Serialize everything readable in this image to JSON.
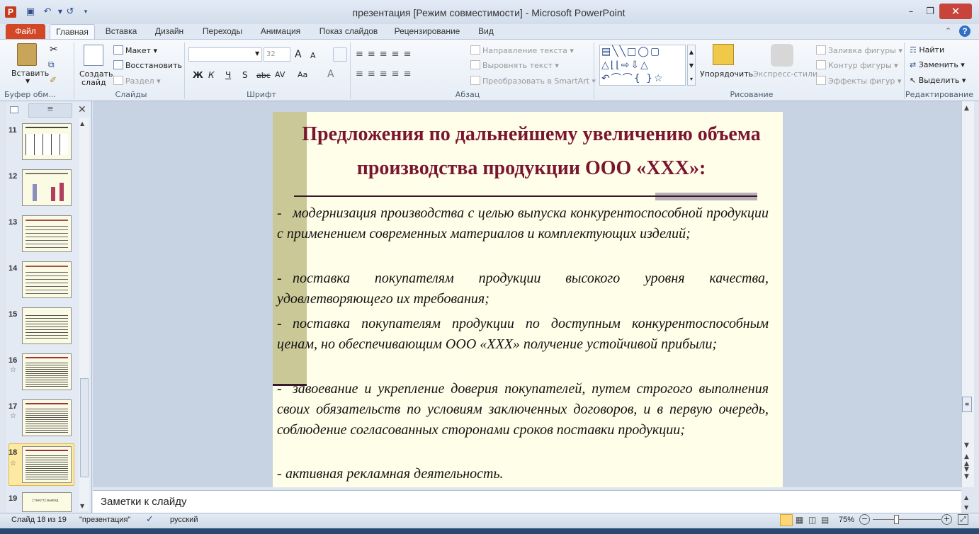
{
  "window": {
    "title": "презентация [Режим совместимости] - Microsoft PowerPoint",
    "app_icon_letter": "P"
  },
  "ribbon_tabs": [
    "Файл",
    "Главная",
    "Вставка",
    "Дизайн",
    "Переходы",
    "Анимация",
    "Показ слайдов",
    "Рецензирование",
    "Вид"
  ],
  "ribbon": {
    "clipboard": {
      "paste": "Вставить",
      "group": "Буфер обм..."
    },
    "slides": {
      "new_slide_1": "Создать",
      "new_slide_2": "слайд",
      "layout": "Макет",
      "reset": "Восстановить",
      "section": "Раздел",
      "group": "Слайды"
    },
    "font": {
      "size": "32",
      "bold": "Ж",
      "italic": "К",
      "underline": "Ч",
      "shadow": "S",
      "strike": "abc",
      "spacing": "AV",
      "case": "Aa",
      "color": "A",
      "grow": "A",
      "shrink": "A",
      "group": "Шрифт"
    },
    "paragraph": {
      "direction": "Направление текста",
      "align": "Выровнять текст",
      "smartart": "Преобразовать в SmartArt",
      "group": "Абзац"
    },
    "drawing": {
      "arrange": "Упорядочить",
      "quick_styles": "Экспресс-стили",
      "fill": "Заливка фигуры",
      "outline": "Контур фигуры",
      "effects": "Эффекты фигур",
      "group": "Рисование"
    },
    "editing": {
      "find": "Найти",
      "replace": "Заменить",
      "select": "Выделить",
      "group": "Редактирование"
    }
  },
  "slides_panel": {
    "thumbnails": [
      {
        "num": "11",
        "star": ""
      },
      {
        "num": "12",
        "star": ""
      },
      {
        "num": "13",
        "star": ""
      },
      {
        "num": "14",
        "star": ""
      },
      {
        "num": "15",
        "star": ""
      },
      {
        "num": "16",
        "star": "☆"
      },
      {
        "num": "17",
        "star": "☆"
      },
      {
        "num": "18",
        "star": "☆"
      },
      {
        "num": "19",
        "star": ""
      }
    ],
    "selected": "18",
    "thumb19_text": "[текст] вывод"
  },
  "slide": {
    "title_line1": "Предложения по дальнейшему увеличению объема",
    "title_line2": "производства продукции ООО «ХХХ»:",
    "bullets": [
      "модернизация производства с целью выпуска конкурентоспособной продукции с применением современных материалов и комплектующих изделий;",
      "поставка покупателям продукции высокого уровня качества, удовлетворяющего их требования;",
      "поставка покупателям продукции по доступным конкурентоспособным ценам, но обеспечивающим ООО «ХХХ» получение устойчивой прибыли;",
      "завоевание и укрепление доверия покупателей, путем строгого выполнения своих обязательств по условиям заключенных договоров, и в первую очередь, соблюдение согласованных сторонами сроков поставки продукции;",
      "активная рекламная деятельность."
    ],
    "bullet_marker": "-"
  },
  "notes": {
    "placeholder": "Заметки к слайду"
  },
  "status": {
    "slide_info": "Слайд 18 из 19",
    "theme": "\"презентация\"",
    "language": "русский",
    "zoom": "75%"
  },
  "colors": {
    "file_tab": "#d24726",
    "title": "#7a1530",
    "slide_bg": "#fffee8",
    "accent_bar": "#c9c896"
  }
}
